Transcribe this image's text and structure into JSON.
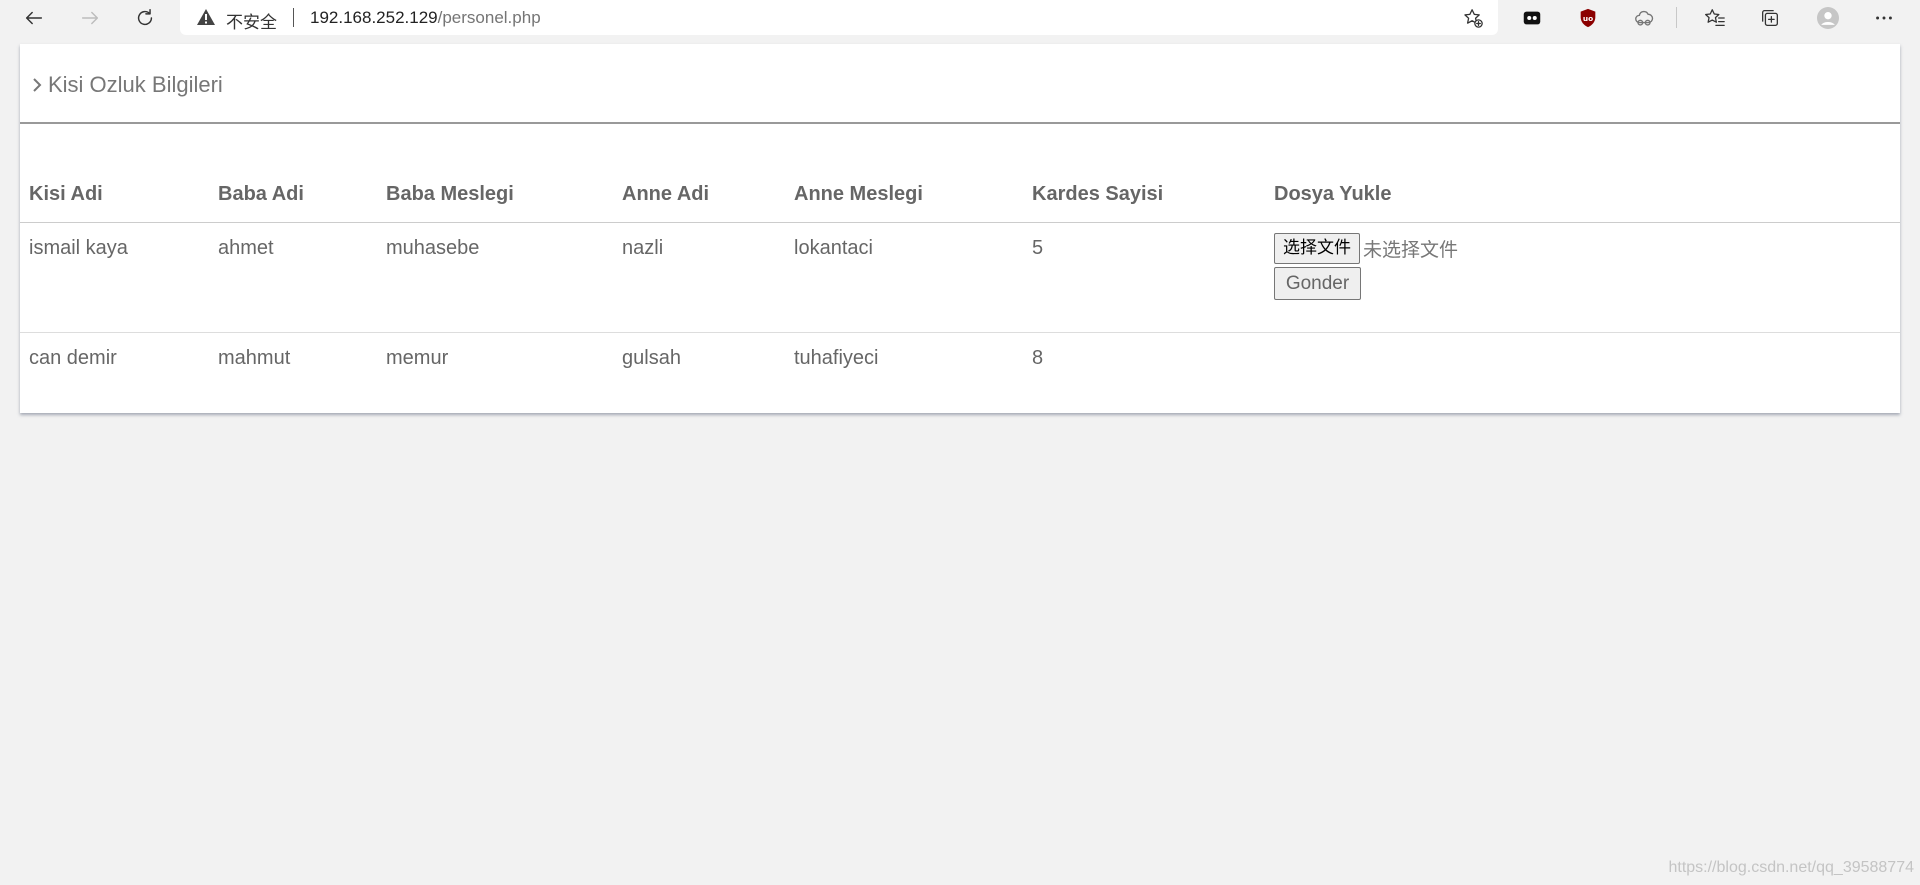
{
  "browser": {
    "security_label": "不安全",
    "url_host": "192.168.252.129",
    "url_path": "/personel.php"
  },
  "page": {
    "title": "Kisi Ozluk Bilgileri"
  },
  "table": {
    "headers": [
      "Kisi Adi",
      "Baba Adi",
      "Baba Meslegi",
      "Anne Adi",
      "Anne Meslegi",
      "Kardes Sayisi",
      "Dosya Yukle"
    ],
    "rows": [
      {
        "kisi_adi": "ismail kaya",
        "baba_adi": "ahmet",
        "baba_meslegi": "muhasebe",
        "anne_adi": "nazli",
        "anne_meslegi": "lokantaci",
        "kardes_sayisi": "5"
      },
      {
        "kisi_adi": "can demir",
        "baba_adi": "mahmut",
        "baba_meslegi": "memur",
        "anne_adi": "gulsah",
        "anne_meslegi": "tuhafiyeci",
        "kardes_sayisi": "8"
      }
    ],
    "upload": {
      "choose_file_label": "选择文件",
      "no_file_label": "未选择文件",
      "submit_label": "Gonder"
    }
  },
  "watermark": "https://blog.csdn.net/qq_39588774",
  "icons": [
    "back-arrow-icon",
    "forward-arrow-icon",
    "refresh-icon",
    "warning-icon",
    "add-favorite-icon",
    "extension-icon",
    "shield-extension-icon",
    "cloud-extension-icon",
    "favorites-icon",
    "collections-icon",
    "profile-avatar-icon",
    "more-menu-icon",
    "chevron-right-icon"
  ]
}
